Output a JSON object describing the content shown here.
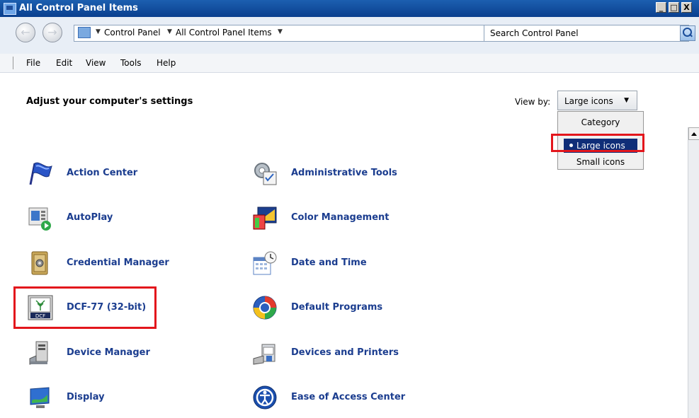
{
  "window": {
    "title": "All Control Panel Items",
    "minimize": "_",
    "maximize": "□",
    "close": "X"
  },
  "addressbar": {
    "back": "←",
    "forward": "→",
    "crumbs": [
      "Control Panel",
      "All Control Panel Items"
    ],
    "search_placeholder": "Search Control Panel"
  },
  "menu": [
    "File",
    "Edit",
    "View",
    "Tools",
    "Help"
  ],
  "content": {
    "heading": "Adjust your computer's settings",
    "view_by_label": "View by:",
    "view_by_value": "Large icons",
    "view_options": [
      "Category",
      "Large icons",
      "Small icons"
    ],
    "selected_view": "Large icons"
  },
  "items_left": [
    {
      "label": "Action Center",
      "icon": "action-center-flag-icon"
    },
    {
      "label": "AutoPlay",
      "icon": "autoplay-icon"
    },
    {
      "label": "Credential Manager",
      "icon": "credential-manager-vault-icon"
    },
    {
      "label": "DCF-77 (32-bit)",
      "icon": "dcf77-icon"
    },
    {
      "label": "Device Manager",
      "icon": "device-manager-icon"
    },
    {
      "label": "Display",
      "icon": "display-icon"
    }
  ],
  "items_right": [
    {
      "label": "Administrative Tools",
      "icon": "administrative-tools-icon"
    },
    {
      "label": "Color Management",
      "icon": "color-management-icon"
    },
    {
      "label": "Date and Time",
      "icon": "date-time-icon"
    },
    {
      "label": "Default Programs",
      "icon": "default-programs-icon"
    },
    {
      "label": "Devices and Printers",
      "icon": "devices-printers-icon"
    },
    {
      "label": "Ease of Access Center",
      "icon": "ease-of-access-icon"
    }
  ],
  "dcf_icon_text": "DCF"
}
